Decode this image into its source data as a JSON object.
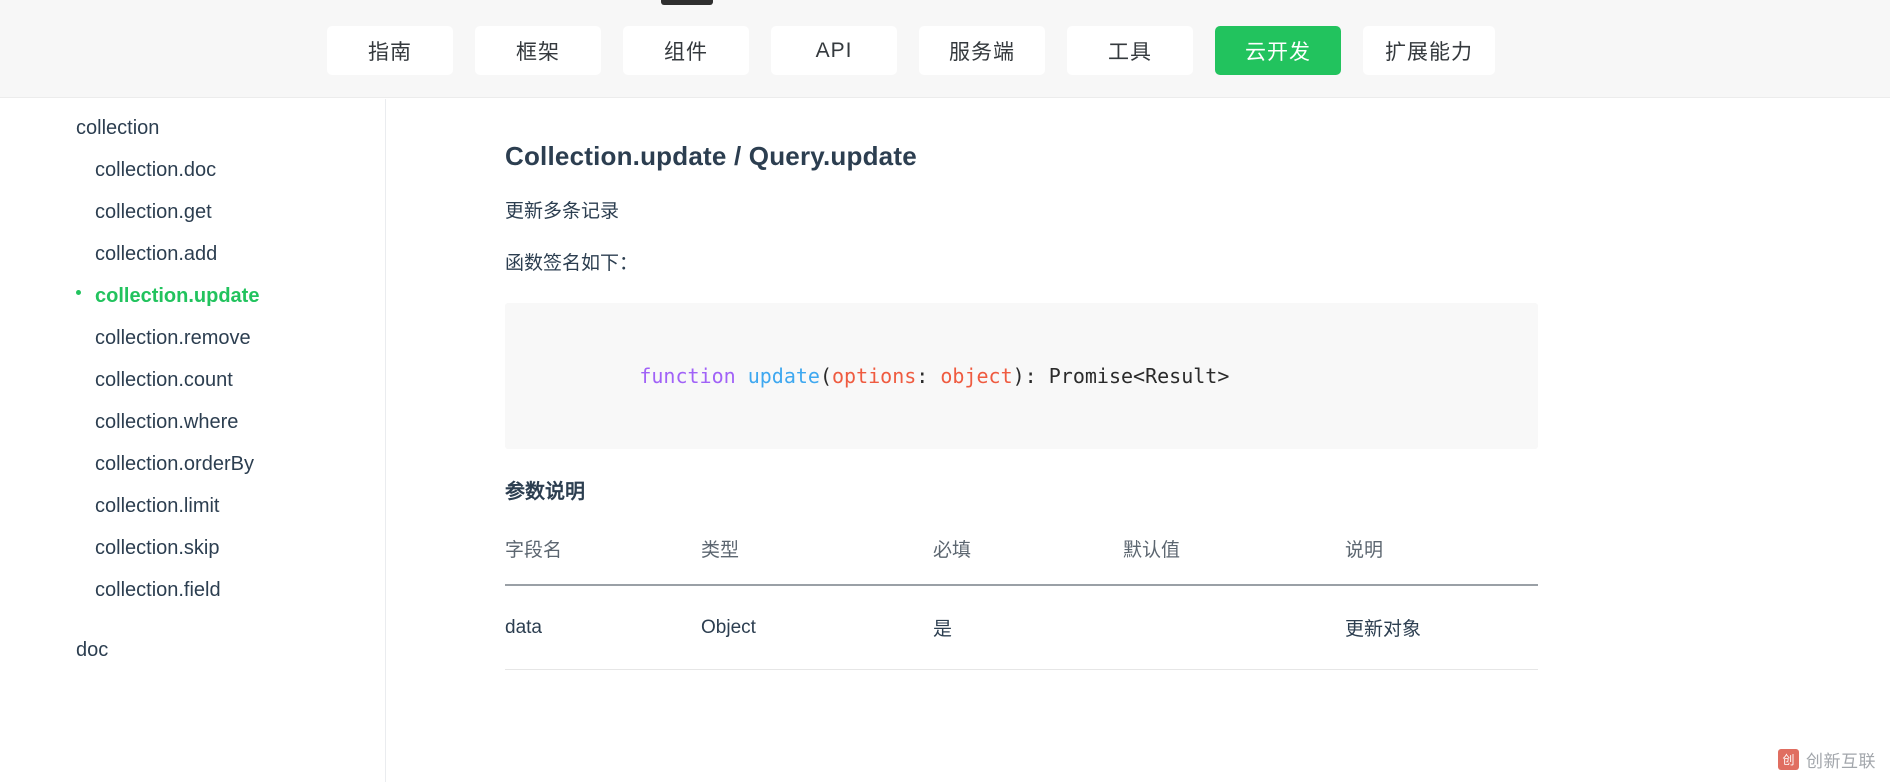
{
  "topnav": {
    "active_indicator": true,
    "items": [
      {
        "label": "指南",
        "active": false
      },
      {
        "label": "框架",
        "active": false
      },
      {
        "label": "组件",
        "active": false
      },
      {
        "label": "API",
        "active": false
      },
      {
        "label": "服务端",
        "active": false
      },
      {
        "label": "工具",
        "active": false
      },
      {
        "label": "云开发",
        "active": true
      },
      {
        "label": "扩展能力",
        "active": false
      }
    ],
    "active_color": "#22c35e"
  },
  "sidebar": {
    "groups": [
      {
        "title": "collection",
        "items": [
          {
            "label": "collection.doc",
            "active": false
          },
          {
            "label": "collection.get",
            "active": false
          },
          {
            "label": "collection.add",
            "active": false
          },
          {
            "label": "collection.update",
            "active": true
          },
          {
            "label": "collection.remove",
            "active": false
          },
          {
            "label": "collection.count",
            "active": false
          },
          {
            "label": "collection.where",
            "active": false
          },
          {
            "label": "collection.orderBy",
            "active": false
          },
          {
            "label": "collection.limit",
            "active": false
          },
          {
            "label": "collection.skip",
            "active": false
          },
          {
            "label": "collection.field",
            "active": false
          }
        ]
      },
      {
        "title": "doc",
        "items": []
      }
    ],
    "active_color": "#22c35e"
  },
  "main": {
    "title": "Collection.update / Query.update",
    "description": "更新多条记录",
    "signature_lead": "函数签名如下：",
    "code": {
      "tokens": [
        {
          "text": "function",
          "kind": "kw"
        },
        {
          "text": " ",
          "kind": "plain"
        },
        {
          "text": "update",
          "kind": "fn"
        },
        {
          "text": "(",
          "kind": "plain"
        },
        {
          "text": "options",
          "kind": "param"
        },
        {
          "text": ": ",
          "kind": "plain"
        },
        {
          "text": "object",
          "kind": "type"
        },
        {
          "text": "): Promise<Result>",
          "kind": "plain"
        }
      ],
      "plain_text": "function update(options: object): Promise<Result>"
    },
    "params_section_title": "参数说明",
    "table": {
      "headers": [
        "字段名",
        "类型",
        "必填",
        "默认值",
        "说明"
      ],
      "rows": [
        [
          "data",
          "Object",
          "是",
          "",
          "更新对象"
        ]
      ]
    }
  },
  "watermark": {
    "text": "创新互联",
    "logo_glyph": "创"
  }
}
